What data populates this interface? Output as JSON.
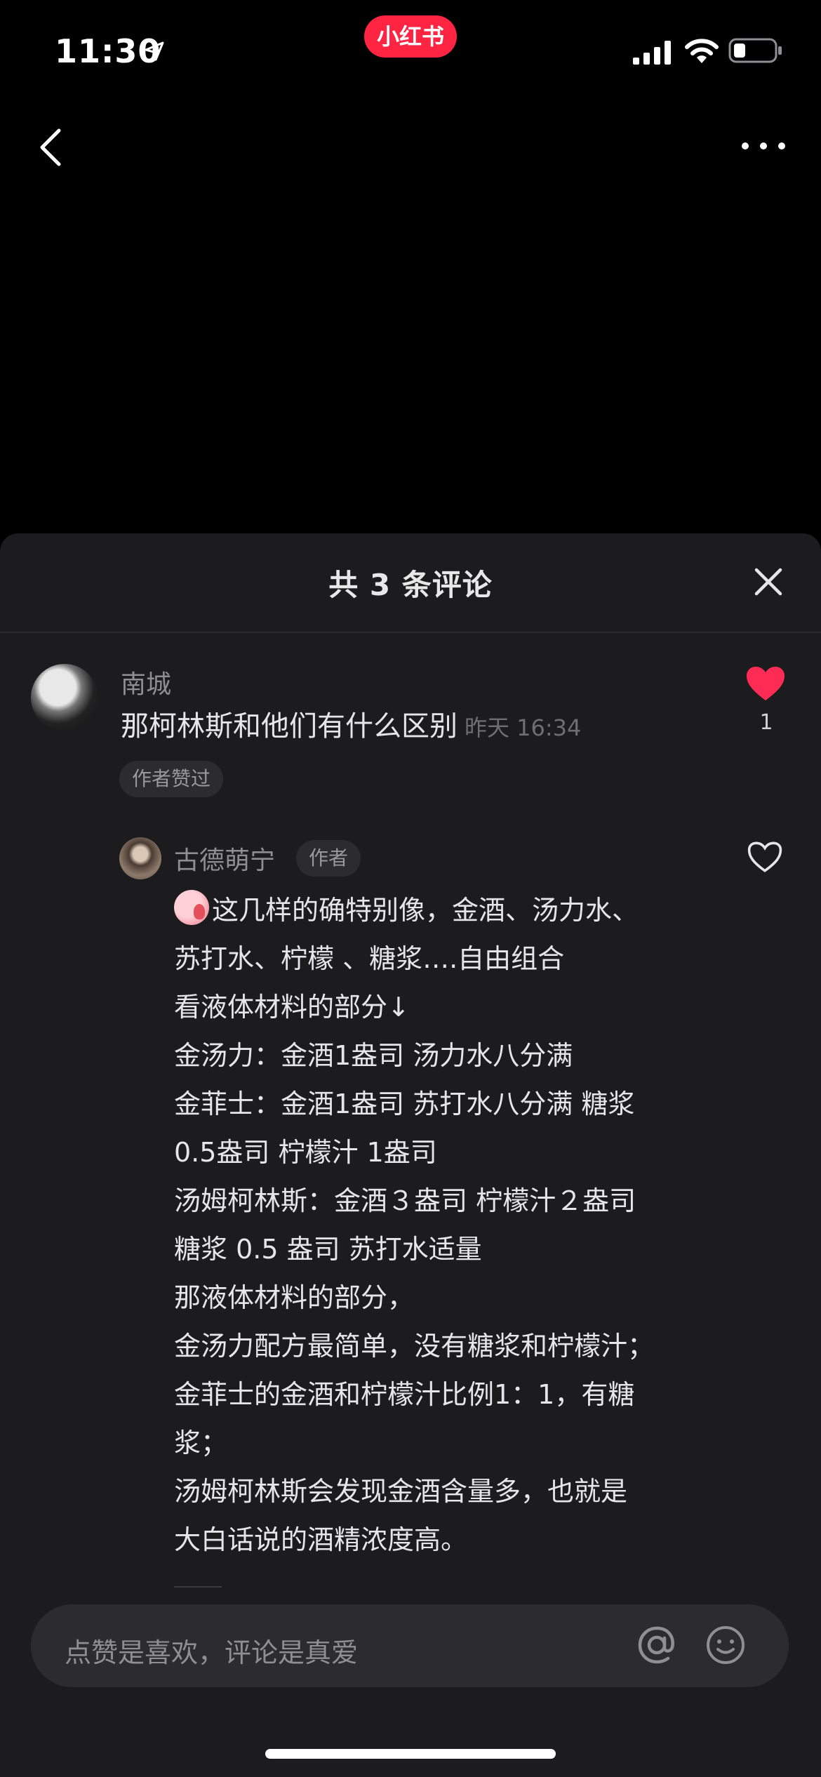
{
  "status_bar": {
    "time": "11:30",
    "app_badge": "小红书",
    "icons": [
      "location-arrow-icon",
      "signal-icon",
      "wifi-icon",
      "battery-icon"
    ]
  },
  "nav": {
    "icons": [
      "back-icon",
      "more-icon"
    ]
  },
  "comments_sheet": {
    "title": "共 3 条评论",
    "close_icon": "close-icon",
    "comment": {
      "user": "南城",
      "text": "那柯林斯和他们有什么区别",
      "time": "昨天 16:34",
      "badge": "作者赞过",
      "like_count": "1",
      "liked": true
    },
    "reply": {
      "user": "古德萌宁",
      "author_tag": "作者",
      "liked": false,
      "lines": [
        "这几样的确特别像，金酒、汤力水、",
        "苏打水、柠檬 、糖浆….自由组合",
        "看液体材料的部分↓",
        "金汤力：金酒1盎司 汤力水八分满",
        "金菲士：金酒1盎司 苏打水八分满 糖浆",
        "0.5盎司 柠檬汁 1盎司",
        "汤姆柯林斯：金酒３盎司 柠檬汁２盎司",
        "糖浆 0.5 盎司 苏打水适量",
        "那液体材料的部分，",
        "金汤力配方最简单，没有糖浆和柠檬汁；",
        "金菲士的金酒和柠檬汁比例1：1，有糖",
        "浆；",
        "汤姆柯林斯会发现金酒含量多，也就是",
        "大白话说的酒精浓度高。"
      ]
    },
    "input": {
      "placeholder": "点赞是喜欢，评论是真爱"
    }
  },
  "colors": {
    "background": "#000000",
    "sheet": "#1c1c1e",
    "accent_red": "#ff2442",
    "like_red": "#fe2c55"
  }
}
